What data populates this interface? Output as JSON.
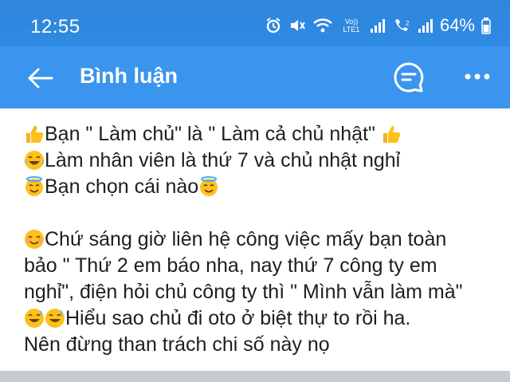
{
  "status_bar": {
    "time": "12:55",
    "carrier_text": "Vo)) LTE1",
    "battery": "64%"
  },
  "app_bar": {
    "title": "Bình luận",
    "back_icon": "arrow-left-icon",
    "chat_icon": "chat-bubble-icon",
    "more_icon": "more-horizontal-icon"
  },
  "post": {
    "lines": [
      {
        "emojis_before": [
          "thumbs-up"
        ],
        "text": "Bạn \" Làm chủ\" là \" Làm cả chủ nhật\" ",
        "emojis_after": [
          "thumbs-up"
        ]
      },
      {
        "emojis_before": [
          "tears-of-joy"
        ],
        "text": "Làm nhân viên là thứ 7 và chủ nhật nghỉ",
        "emojis_after": []
      },
      {
        "emojis_before": [
          "halo"
        ],
        "text": "Bạn chọn cái nào",
        "emojis_after": [
          "halo"
        ]
      },
      {
        "emojis_before": [
          "smiling"
        ],
        "text": "Chứ sáng giờ liên hệ công việc mấy bạn toàn",
        "emojis_after": []
      },
      {
        "emojis_before": [],
        "text": "bảo \" Thứ 2 em báo nha, nay thứ 7 công ty em",
        "emojis_after": []
      },
      {
        "emojis_before": [],
        "text": "nghỉ\", điện hỏi chủ công ty thì \" Mình vẫn làm mà\"",
        "emojis_after": []
      },
      {
        "emojis_before": [
          "sweat-smile",
          "sweat-smile"
        ],
        "text": "Hiểu sao chủ đi oto ở biệt thự to rồi ha.",
        "emojis_after": []
      },
      {
        "emojis_before": [],
        "text": "Nên đừng than trách chi số này nọ",
        "emojis_after": []
      }
    ]
  },
  "colors": {
    "status_bar": "#2f88e0",
    "app_bar": "#3b95ee",
    "text": "#1c1e21"
  }
}
